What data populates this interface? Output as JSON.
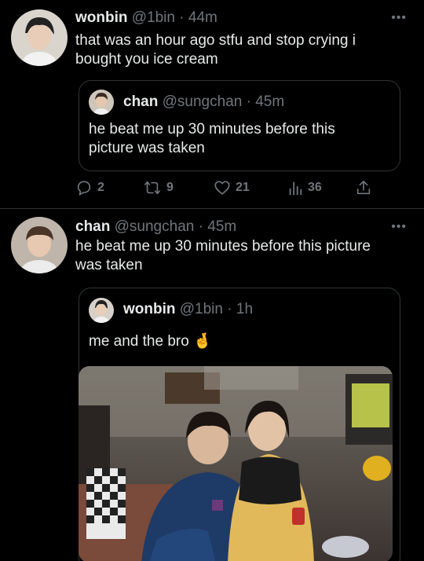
{
  "tweet1": {
    "name": "wonbin",
    "handle": "@1bin",
    "dot": "·",
    "time": "44m",
    "more": "•••",
    "text_line1": "that was an hour ago stfu and stop crying i",
    "text_line2": "bought you ice cream",
    "quote": {
      "name": "chan",
      "handle": "@sungchan",
      "dot": "·",
      "time": "45m",
      "text_line1": "he beat me up 30 minutes before this",
      "text_line2": "picture was taken"
    },
    "actions": {
      "replies": "2",
      "retweets": "9",
      "likes": "21",
      "views": "36"
    }
  },
  "tweet2": {
    "name": "chan",
    "handle": "@sungchan",
    "dot": "·",
    "time": "45m",
    "more": "•••",
    "text_line1": "he beat me up 30 minutes before this picture",
    "text_line2": "was taken",
    "quote": {
      "name": "wonbin",
      "handle": "@1bin",
      "dot": "·",
      "time": "1h",
      "text": "me and the bro 🤞"
    }
  },
  "colors": {
    "background": "#000000",
    "text": "#e7e9ea",
    "secondary": "#71767b",
    "border": "#2f3336"
  }
}
